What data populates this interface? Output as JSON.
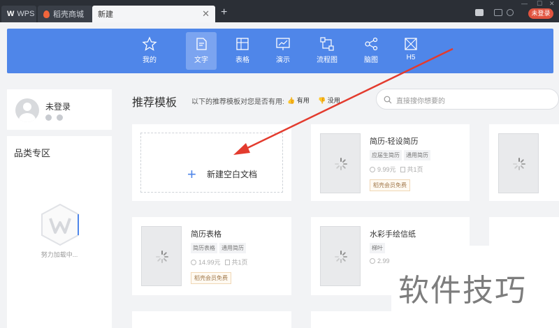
{
  "titlebar": {
    "tabs": [
      {
        "label": "WPS",
        "logo": "W"
      },
      {
        "label": "稻壳商城"
      },
      {
        "label": "新建"
      }
    ],
    "login_label": "未登录"
  },
  "toolbar": {
    "items": [
      {
        "label": "我的",
        "icon": "star-icon"
      },
      {
        "label": "文字",
        "icon": "document-icon",
        "active": true
      },
      {
        "label": "表格",
        "icon": "spreadsheet-icon"
      },
      {
        "label": "演示",
        "icon": "presentation-icon"
      },
      {
        "label": "流程图",
        "icon": "flowchart-icon"
      },
      {
        "label": "脑图",
        "icon": "mindmap-icon"
      },
      {
        "label": "H5",
        "icon": "h5-icon"
      }
    ],
    "accent": "#4f86e9"
  },
  "user": {
    "name": "未登录"
  },
  "category": {
    "title": "品类专区",
    "loading_text": "努力加载中..."
  },
  "main": {
    "title": "推荐模板",
    "hint": "以下的推荐模板对您是否有用:",
    "useful": "有用",
    "useless": "没用",
    "search_placeholder": "直接搜你想要的"
  },
  "blank_card": {
    "plus": "+",
    "label": "新建空白文档"
  },
  "cards": [
    {
      "title": "简历-轻设简历",
      "tags": [
        "应届生简历",
        "通用简历"
      ],
      "price": "9.99元",
      "pages": "共1页",
      "badge": "稻壳会员免费"
    },
    {
      "title": "简历表格",
      "tags": [
        "简历表格",
        "通用简历"
      ],
      "price": "14.99元",
      "pages": "共1页",
      "badge": "稻壳会员免费"
    },
    {
      "title": "水彩手绘信纸",
      "tags": [
        "梯叶"
      ],
      "price": "2.99",
      "pages": "",
      "badge": ""
    }
  ],
  "watermark": "软件技巧"
}
